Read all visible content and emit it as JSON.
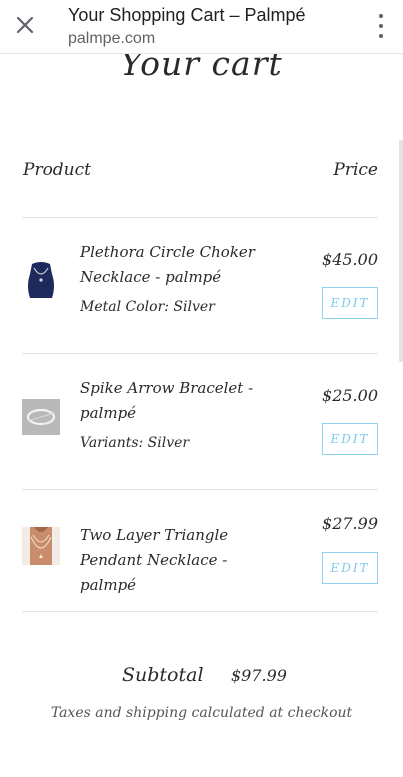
{
  "browser": {
    "title": "Your Shopping Cart – Palmpé",
    "url": "palmpe.com",
    "close_icon": "close-icon",
    "menu_icon": "more-vert-icon"
  },
  "cart": {
    "title": "Your cart",
    "col_product": "Product",
    "col_price": "Price",
    "edit_label": "EDIT",
    "items": [
      {
        "name": "Plethora Circle Choker Necklace - palmpé",
        "variant": "Metal Color: Silver",
        "price": "$45.00"
      },
      {
        "name": "Spike Arrow Bracelet - palmpé",
        "variant": "Variants: Silver",
        "price": "$25.00"
      },
      {
        "name": "Two Layer Triangle Pendant Necklace - palmpé",
        "variant": "",
        "price": "$27.99"
      }
    ],
    "subtotal_label": "Subtotal",
    "subtotal_value": "$97.99",
    "tax_note": "Taxes and shipping calculated at checkout"
  },
  "colors": {
    "accent_edit": "#7fc9ee",
    "text": "#2a2a2a"
  }
}
